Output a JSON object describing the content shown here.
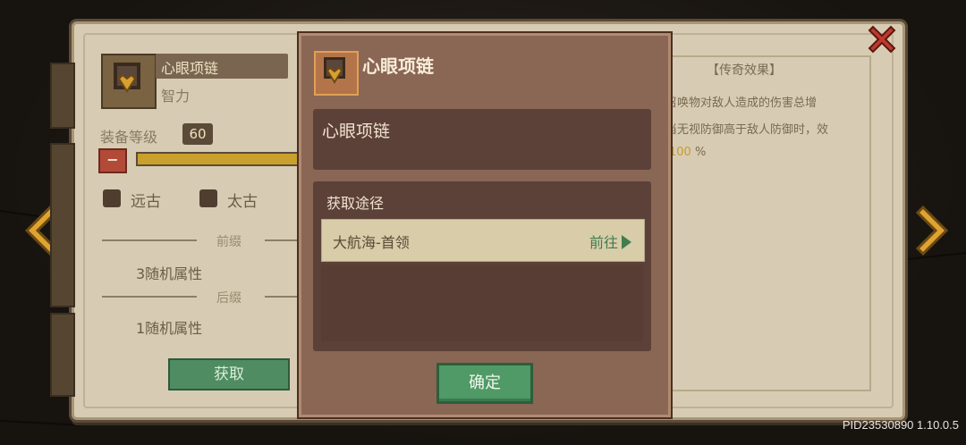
{
  "item": {
    "name": "心眼项链",
    "attribute": "智力",
    "level_label": "装备等级",
    "level_value": "60",
    "level_progress": 1.0
  },
  "filters": [
    {
      "label": "远古"
    },
    {
      "label": "太古"
    }
  ],
  "prefix": {
    "label": "前缀",
    "value": "3随机属性"
  },
  "suffix": {
    "label": "后缀",
    "value": "1随机属性"
  },
  "obtain_button": "获取",
  "legend": {
    "title": "【传奇效果】",
    "line1": "召唤物对敌人造成的伤害总增",
    "line2": "当无视防御高于敌人防御时，效",
    "value": "100",
    "unit": "%"
  },
  "modal": {
    "title": "心眼项链",
    "info_text": "心眼项链",
    "source_label": "获取途径",
    "sources": [
      {
        "name": "大航海-首领",
        "action": "前往"
      }
    ],
    "confirm_label": "确定"
  },
  "version": "PID23530890 1.10.0.5",
  "colors": {
    "accent_gold": "#e0a330",
    "close_red": "#c0392b",
    "confirm_green": "#4f9a66",
    "modal_bg": "#8a6654"
  }
}
